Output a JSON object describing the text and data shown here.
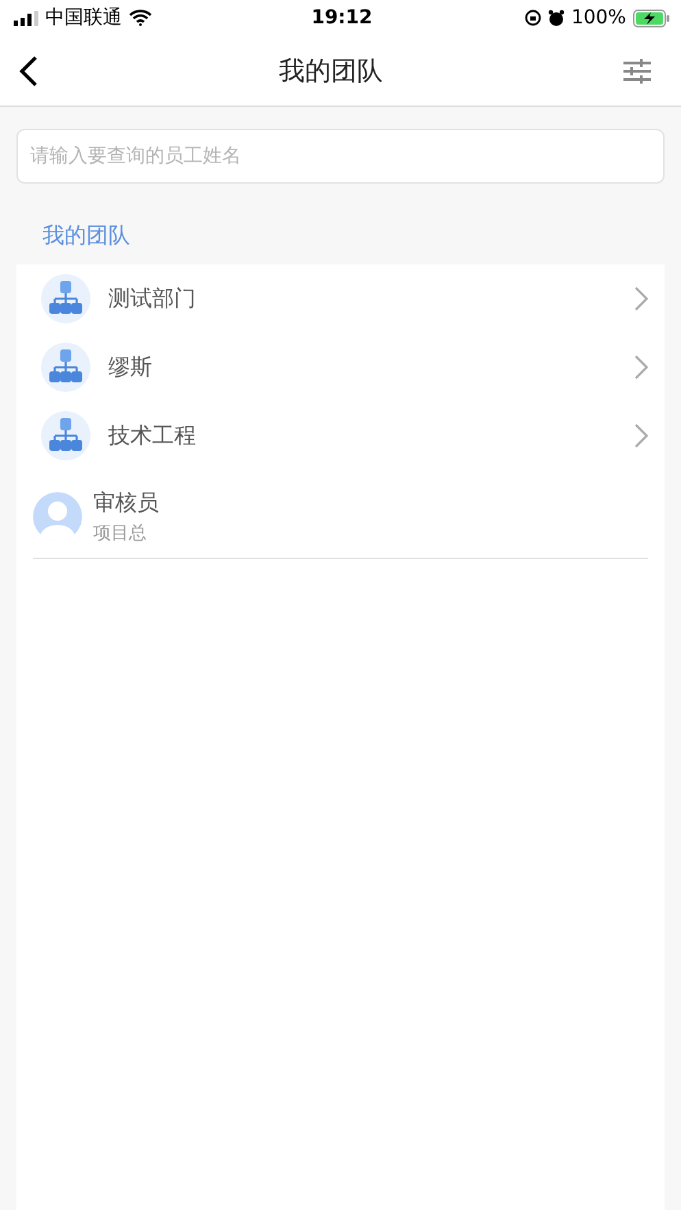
{
  "status_bar": {
    "carrier": "中国联通",
    "time": "19:12",
    "battery": "100%"
  },
  "nav": {
    "title": "我的团队"
  },
  "search": {
    "placeholder": "请输入要查询的员工姓名"
  },
  "section_title": "我的团队",
  "members": [
    {
      "kind": "department",
      "name": "测试部门"
    },
    {
      "kind": "department",
      "name": "缪斯"
    },
    {
      "kind": "department",
      "name": "技术工程"
    },
    {
      "kind": "person",
      "name": "审核员",
      "role": "项目总"
    }
  ]
}
